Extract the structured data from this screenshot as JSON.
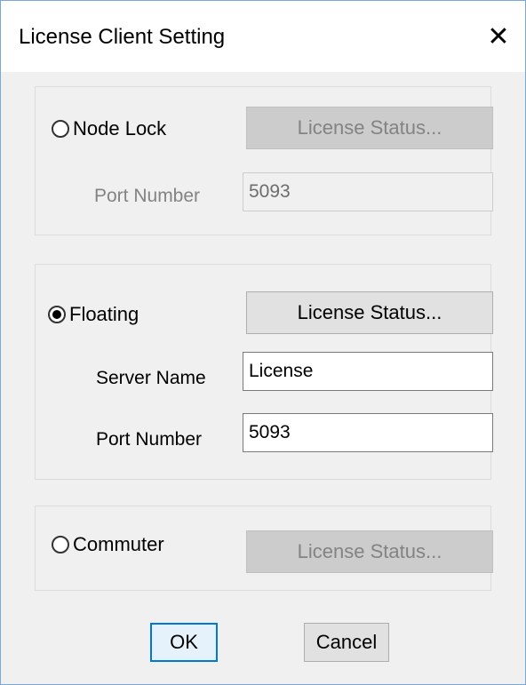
{
  "dialog": {
    "title": "License Client Setting",
    "close_glyph": "✕"
  },
  "node_lock": {
    "label": "Node Lock",
    "selected": false,
    "status_button": "License Status...",
    "port_label": "Port Number",
    "port_value": "5093"
  },
  "floating": {
    "label": "Floating",
    "selected": true,
    "status_button": "License Status...",
    "server_label": "Server Name",
    "server_value": "License",
    "port_label": "Port Number",
    "port_value": "5093"
  },
  "commuter": {
    "label": "Commuter",
    "selected": false,
    "status_button": "License Status..."
  },
  "footer": {
    "ok_label": "OK",
    "cancel_label": "Cancel"
  }
}
